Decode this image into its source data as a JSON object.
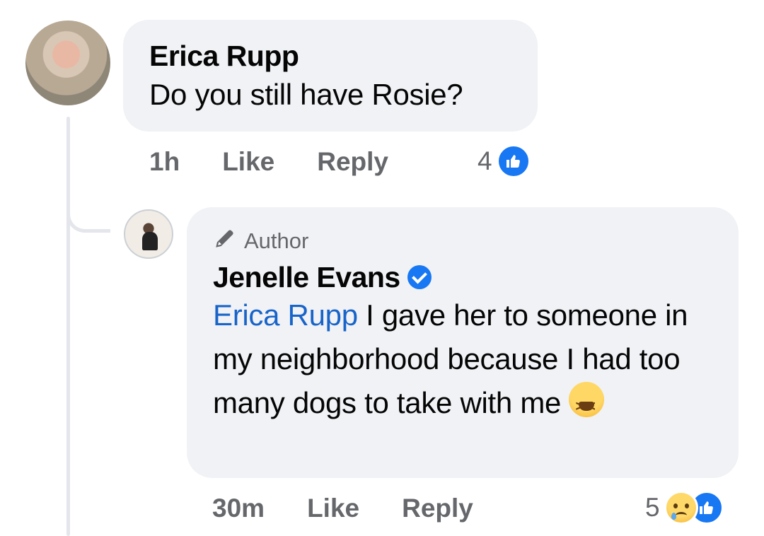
{
  "comments": [
    {
      "author": "Erica Rupp",
      "text": "Do you still have Rosie?",
      "time": "1h",
      "like_label": "Like",
      "reply_label": "Reply",
      "reaction_count": "4",
      "reactions": [
        "like-icon"
      ]
    },
    {
      "badge": "Author",
      "author": "Jenelle Evans",
      "verified": true,
      "mention": "Erica Rupp",
      "text": " I gave her to someone in my neighborhood because I had too many dogs to take with me ",
      "emoji": "tired-face-emoji",
      "time": "30m",
      "like_label": "Like",
      "reply_label": "Reply",
      "reaction_count": "5",
      "reactions": [
        "sad-icon",
        "like-icon"
      ]
    }
  ],
  "colors": {
    "bubble": "#f0f2f5",
    "secondary_text": "#65676b",
    "link": "#1864c9",
    "brand_blue": "#1877f2"
  }
}
